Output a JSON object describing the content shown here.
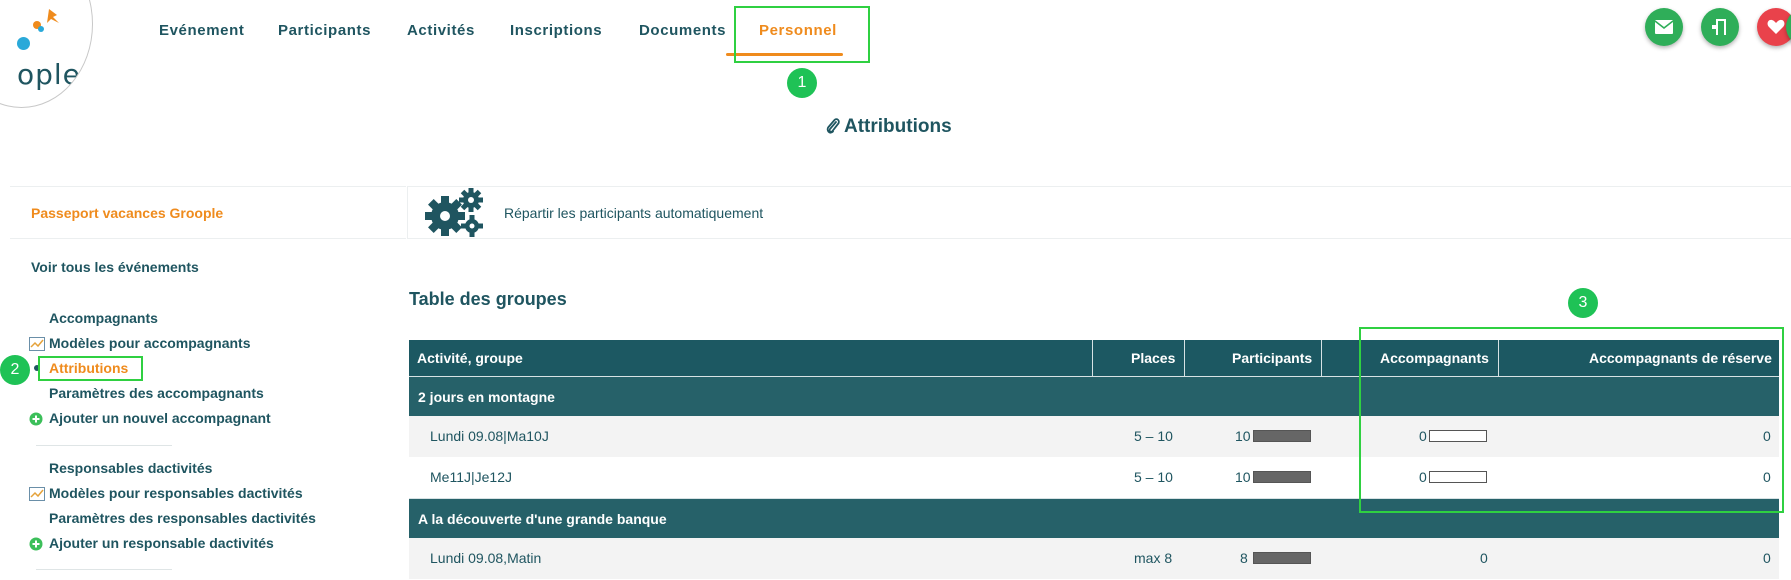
{
  "logo": {
    "text": "ople",
    "mark_colors": [
      "#ef8b1d",
      "#2aa9d9"
    ]
  },
  "nav": {
    "items": [
      "Evénement",
      "Participants",
      "Activités",
      "Inscriptions",
      "Documents",
      "Personnel"
    ],
    "active": "Personnel",
    "accent": "#ef8b1d"
  },
  "actions": [
    {
      "icon": "envelope-icon",
      "color": "#2fae59"
    },
    {
      "icon": "door-exit-icon",
      "color": "#2fae59"
    },
    {
      "icon": "heart-icon",
      "color": "#e9424b"
    }
  ],
  "annotations": {
    "badge1": "1",
    "badge2": "2",
    "badge3": "3",
    "highlight_color": "#2fd041"
  },
  "page_title": "Attributions",
  "sidebar": {
    "event": "Passeport vacances Groople",
    "all_events": "Voir tous les événements",
    "group1": [
      {
        "label": "Accompagnants",
        "icon": ""
      },
      {
        "label": "Modèles pour accompagnants",
        "icon": "template-icon"
      },
      {
        "label": "Attributions",
        "icon": "bullet-icon",
        "active": true
      },
      {
        "label": "Paramètres des accompagnants",
        "icon": ""
      },
      {
        "label": "Ajouter un nouvel accompagnant",
        "icon": "add-icon"
      }
    ],
    "group2": [
      {
        "label": "Responsables dactivités",
        "icon": ""
      },
      {
        "label": "Modèles pour responsables dactivités",
        "icon": "template-icon"
      },
      {
        "label": "Paramètres des responsables dactivités",
        "icon": ""
      },
      {
        "label": "Ajouter un responsable dactivités",
        "icon": "add-icon"
      }
    ]
  },
  "auto_assign": {
    "label": "Répartir les participants automatiquement",
    "icon": "gears-icon"
  },
  "table": {
    "title": "Table des groupes",
    "headers": {
      "activity": "Activité, groupe",
      "places": "Places",
      "participants": "Participants",
      "companions": "Accompagnants",
      "reserve": "Accompagnants de réserve"
    },
    "groups": [
      {
        "name": "2 jours en montagne",
        "rows": [
          {
            "name": "Lundi 09.08|Ma10J",
            "places": "5 – 10",
            "participants": "10",
            "participants_fill": 1.0,
            "companions": "0",
            "companions_fill": 0.0,
            "show_companion_bar": true,
            "reserve": "0"
          },
          {
            "name": "Me11J|Je12J",
            "places": "5 – 10",
            "participants": "10",
            "participants_fill": 1.0,
            "companions": "0",
            "companions_fill": 0.0,
            "show_companion_bar": true,
            "reserve": "0"
          }
        ]
      },
      {
        "name": "A la découverte d'une grande banque",
        "rows": [
          {
            "name": "Lundi 09.08,Matin",
            "places": "max 8",
            "participants": "8",
            "participants_fill": 1.0,
            "companions": "0",
            "companions_fill": 0.0,
            "show_companion_bar": false,
            "reserve": "0"
          }
        ]
      }
    ]
  }
}
